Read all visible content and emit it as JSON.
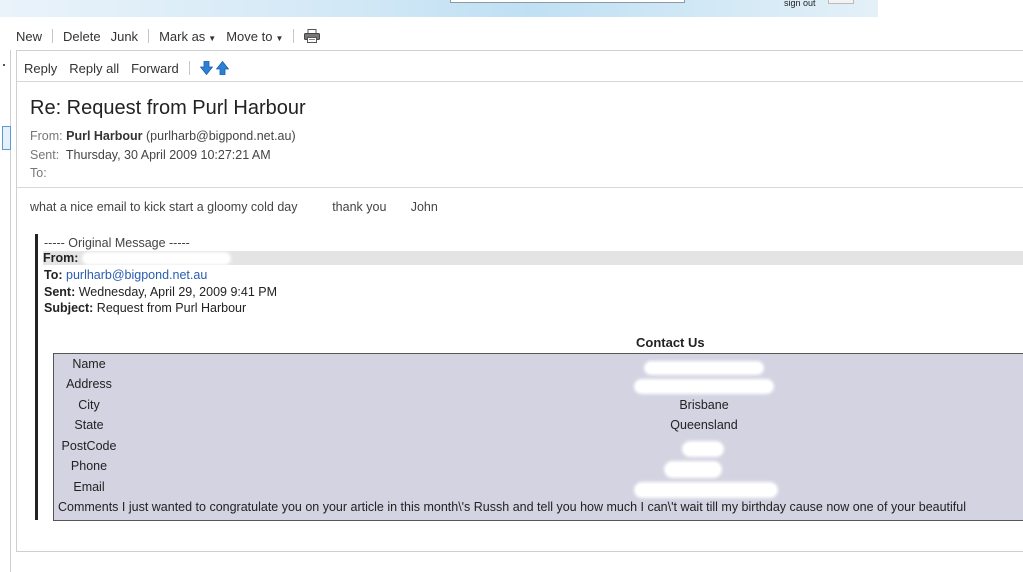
{
  "header": {
    "signout_label": "sign out"
  },
  "toolbar": {
    "new_label": "New",
    "delete_label": "Delete",
    "junk_label": "Junk",
    "markas_label": "Mark as",
    "moveto_label": "Move to",
    "print_icon": "print-icon"
  },
  "message_toolbar": {
    "reply_label": "Reply",
    "replyall_label": "Reply all",
    "forward_label": "Forward",
    "next_icon": "arrow-down-icon",
    "prev_icon": "arrow-up-icon"
  },
  "message": {
    "subject": "Re: Request from Purl Harbour",
    "from_label": "From:",
    "from_name": "Purl Harbour",
    "from_email": "(purlharb@bigpond.net.au)",
    "sent_label": "Sent:",
    "sent_value": "Thursday, 30 April 2009 10:27:21 AM",
    "to_label": "To:",
    "body": "what a nice email to kick start a gloomy cold day          thank you       John"
  },
  "original": {
    "title": "----- Original Message -----",
    "from_label": "From:",
    "to_label": "To:",
    "to_value": "purlharb@bigpond.net.au",
    "sent_label": "Sent:",
    "sent_value": "Wednesday, April 29, 2009 9:41 PM",
    "subject_label": "Subject:",
    "subject_value": "Request from Purl Harbour"
  },
  "contact": {
    "title": "Contact Us",
    "rows": [
      {
        "label": "Name",
        "value": ""
      },
      {
        "label": "Address",
        "value": ""
      },
      {
        "label": "City",
        "value": "Brisbane"
      },
      {
        "label": "State",
        "value": "Queensland"
      },
      {
        "label": "PostCode",
        "value": ""
      },
      {
        "label": "Phone",
        "value": ""
      },
      {
        "label": "Email",
        "value": ""
      }
    ],
    "comments": "Comments I just wanted to congratulate you on your article in this month\\'s Russh and tell you how much I can\\'t wait till my birthday cause now one of your beautiful"
  }
}
